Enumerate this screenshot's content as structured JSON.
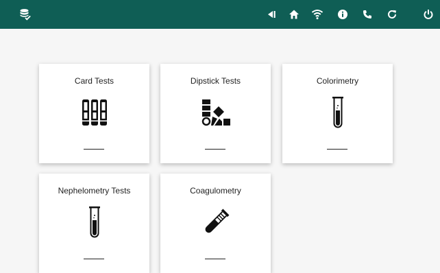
{
  "topbar": {
    "background": "#0f5e55",
    "icons": [
      "database-check-icon",
      "back-icon",
      "home-icon",
      "wifi-icon",
      "info-icon",
      "phone-icon",
      "refresh-icon",
      "power-icon"
    ]
  },
  "cards": [
    {
      "title": "Card Tests",
      "icon": "card-strips-icon"
    },
    {
      "title": "Dipstick Tests",
      "icon": "dipstick-swatch-icon"
    },
    {
      "title": "Colorimetry",
      "icon": "test-tube-icon"
    },
    {
      "title": "Nephelometry Tests",
      "icon": "test-tube-icon"
    },
    {
      "title": "Coagulometry",
      "icon": "coagulometry-tube-icon"
    }
  ]
}
